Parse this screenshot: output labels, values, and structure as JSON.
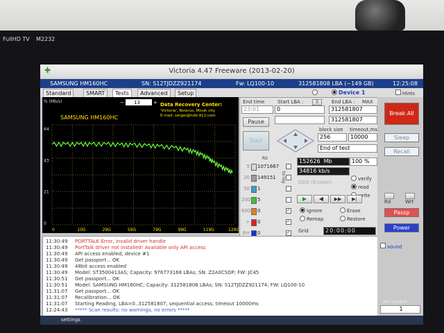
{
  "window": {
    "title": "Victoria 4.47  Freeware (2013-02-20)"
  },
  "infobar": {
    "model": "SAMSUNG HM160HC",
    "serial": "SN: S12TJDZZ921174",
    "firmware": "Fw: LQ100-10",
    "lba": "312581808 LBA (~149 GB)",
    "clock": "12:25:08"
  },
  "tabs": [
    "Standard",
    "SMART",
    "Tests",
    "Advanced",
    "Setup"
  ],
  "device": {
    "label": "Device 1",
    "hints": "Hints"
  },
  "graph": {
    "unit": "% (Mb/s)",
    "scale": "13",
    "drive": "SAMSUNG HM160HC",
    "drc_title": "Data Recovery Center:",
    "drc_city": "'Victoria', Belarus, Minsk city",
    "drc_email": "E-mail: sergei@hdd-911.com",
    "y_ticks": [
      "64",
      "43",
      "21",
      "0"
    ],
    "x_ticks": [
      "0",
      "10G",
      "29G",
      "59G",
      "79G",
      "99G",
      "119G",
      "129G"
    ]
  },
  "chart_data": {
    "type": "line",
    "series": [
      {
        "values": [
          58,
          58,
          58,
          58,
          58,
          57.6,
          57.5,
          57,
          56.5,
          55.5,
          54,
          52.5,
          50.5,
          48,
          45,
          42,
          39.5,
          37.5
        ]
      }
    ],
    "x": [
      0,
      10,
      20,
      29,
      40,
      50,
      59,
      70,
      79,
      90,
      99,
      105,
      110,
      115,
      119,
      124,
      129,
      133
    ],
    "xlim": [
      0,
      135
    ],
    "ylim": [
      0,
      72
    ],
    "grid": true
  },
  "controls": {
    "end_time_label": "End time",
    "end_time_value": "23:01",
    "start_lba_label": "Start LBA :",
    "start_lba_value": "0",
    "end_lba_label": "End LBA :",
    "end_lba_max": "MAX",
    "end_lba_value": "312581807",
    "cur_lba_value": "312581807",
    "pause": "Pause",
    "start": "Start",
    "block_size_label": "block size",
    "block_size_value": "256",
    "timeout_label": "timeout,ms",
    "timeout_value": "10000",
    "end_mode_value": "End of test",
    "break_all": "Break All",
    "sleep": "Sleep",
    "recall": "Recall",
    "passp": "Passp",
    "power": "Power",
    "sound": "sound",
    "api_label": "API number",
    "api_value": "1",
    "rd": "Rd",
    "wrt": "Wrt"
  },
  "stats": {
    "mb": "152626",
    "mb_unit": "Mb",
    "percent": "100",
    "percent_unit": "%",
    "speed": "34816",
    "speed_unit": "kb/s",
    "timer": "20:00:00",
    "ddd": "DDD (Enable)",
    "grid": "Grid",
    "rs": "RS",
    "to_log": "to log"
  },
  "counters": [
    {
      "label": "5",
      "value": "1071667"
    },
    {
      "label": "20",
      "value": "149151"
    },
    {
      "label": "50",
      "value": "1"
    },
    {
      "label": "200",
      "value": "5"
    },
    {
      "label": "600",
      "value": "0"
    },
    {
      "label": ">",
      "value": "0"
    },
    {
      "label": "Err",
      "value": "0"
    }
  ],
  "mode_radios": [
    "verify",
    "read",
    "write"
  ],
  "action_radios": [
    "Ignore",
    "Erase",
    "Remap",
    "Restore"
  ],
  "log": [
    {
      "time": "11:30:49",
      "text": "PORTTALK Error, invalid driver handle",
      "color": "#d03030"
    },
    {
      "time": "11:30:49",
      "text": "PortTalk driver not installed! Available only API access",
      "color": "#d03030"
    },
    {
      "time": "11:30:49",
      "text": "API access enabled, device #1",
      "color": "#333333"
    },
    {
      "time": "11:30:49",
      "text": "Get passport... OK",
      "color": "#333333"
    },
    {
      "time": "11:30:49",
      "text": "48bit access enabled",
      "color": "#333333"
    },
    {
      "time": "11:30:49",
      "text": "Model: ST3500413AS; Capacity: 976773168 LBAs; SN: Z2A0CSDP; FW: JC45",
      "color": "#333333"
    },
    {
      "time": "11:30:51",
      "text": "Get passport... OK",
      "color": "#333333"
    },
    {
      "time": "11:30:51",
      "text": "Model: SAMSUNG HM160HC; Capacity: 312581808 LBAs; SN: S12TJDZZ921174; FW: LQ100-10",
      "color": "#333333"
    },
    {
      "time": "11:31:07",
      "text": "Get passport... OK",
      "color": "#333333"
    },
    {
      "time": "11:31:07",
      "text": "Recalibration... OK",
      "color": "#333333"
    },
    {
      "time": "11:31:07",
      "text": "Starting Reading, LBA=0..312581807, sequential access, timeout 10000ms",
      "color": "#333333"
    },
    {
      "time": "12:24:43",
      "text": "***** Scan results: no warnings, no errors *****",
      "color": "#3a5fd0"
    }
  ],
  "bezel": {
    "brand": "FullHD TV",
    "model": "M2232"
  },
  "taskbar": {
    "item": "settings"
  }
}
